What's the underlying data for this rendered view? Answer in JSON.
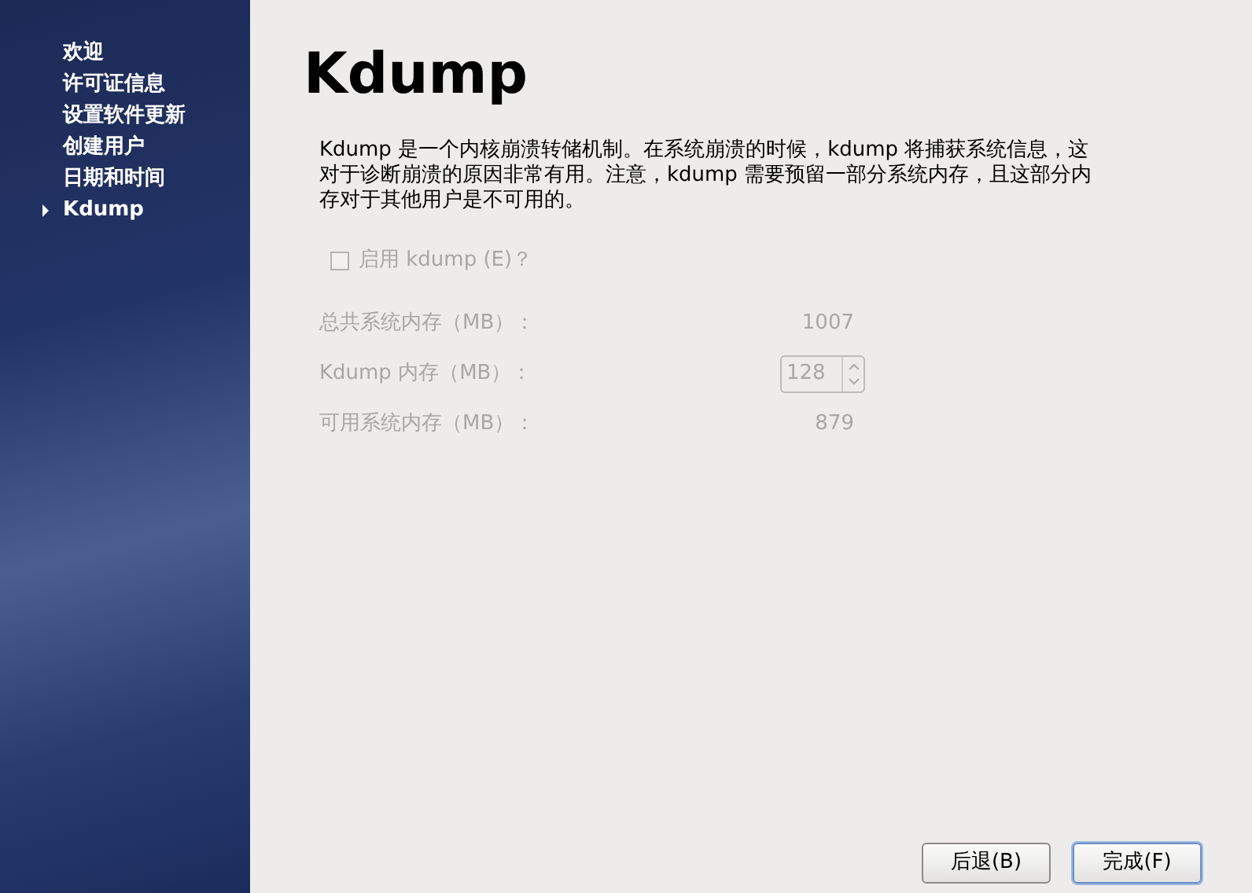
{
  "sidebar": {
    "items": [
      {
        "label": "欢迎",
        "selected": false
      },
      {
        "label": "许可证信息",
        "selected": false
      },
      {
        "label": "设置软件更新",
        "selected": false
      },
      {
        "label": "创建用户",
        "selected": false
      },
      {
        "label": "日期和时间",
        "selected": false
      },
      {
        "label": "Kdump",
        "selected": true
      }
    ]
  },
  "page": {
    "title": "Kdump",
    "description": "Kdump 是一个内核崩溃转储机制。在系统崩溃的时候，kdump 将捕获系统信息，这对于诊断崩溃的原因非常有用。注意，kdump 需要预留一部分系统内存，且这部分内存对于其他用户是不可用的。",
    "enable": {
      "label": "启用 kdump (E)？",
      "checked": false,
      "disabled": true
    },
    "fields": [
      {
        "kind": "value",
        "label": "总共系统内存（MB）：",
        "value": "1007",
        "disabled": true
      },
      {
        "kind": "spin",
        "label": "Kdump 内存（MB）：",
        "value": "128",
        "disabled": true
      },
      {
        "kind": "value",
        "label": "可用系统内存（MB）：",
        "value": "879",
        "disabled": true
      }
    ]
  },
  "buttons": [
    {
      "label": "后退(B)",
      "kind": "normal"
    },
    {
      "label": "完成(F)",
      "kind": "default"
    }
  ]
}
